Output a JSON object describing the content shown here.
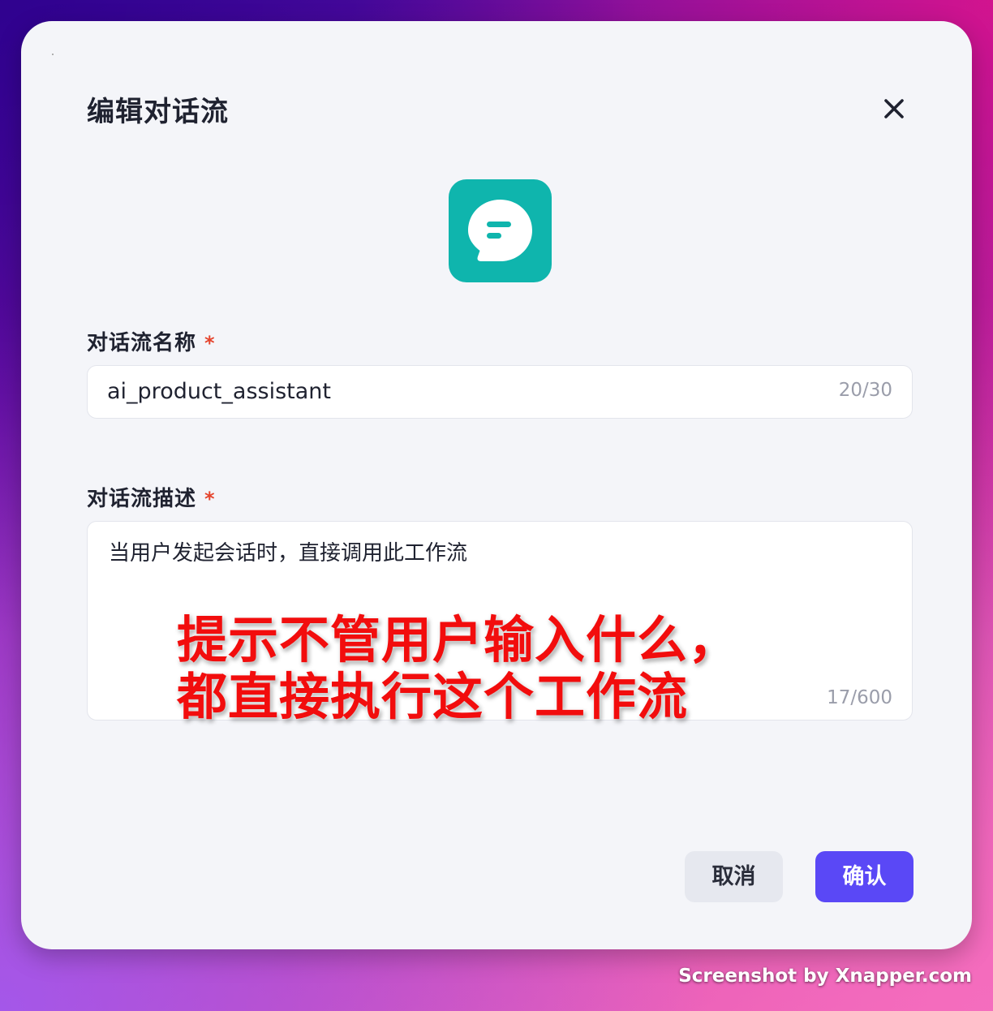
{
  "dialog": {
    "title": "编辑对话流",
    "close_icon": "close-icon",
    "app_icon": "chat-bubble-icon",
    "app_icon_color": "#0fb5ad"
  },
  "form": {
    "name_label": "对话流名称",
    "name_required_mark": "*",
    "name_value": "ai_product_assistant",
    "name_counter": "20/30",
    "desc_label": "对话流描述",
    "desc_required_mark": "*",
    "desc_value": "当用户发起会话时，直接调用此工作流",
    "desc_counter": "17/600"
  },
  "annotation": {
    "line1": "提示不管用户输入什么，",
    "line2": "都直接执行这个工作流"
  },
  "footer": {
    "cancel_label": "取消",
    "confirm_label": "确认",
    "confirm_color": "#5a48f6"
  },
  "watermark": "Screenshot by Xnapper.com"
}
